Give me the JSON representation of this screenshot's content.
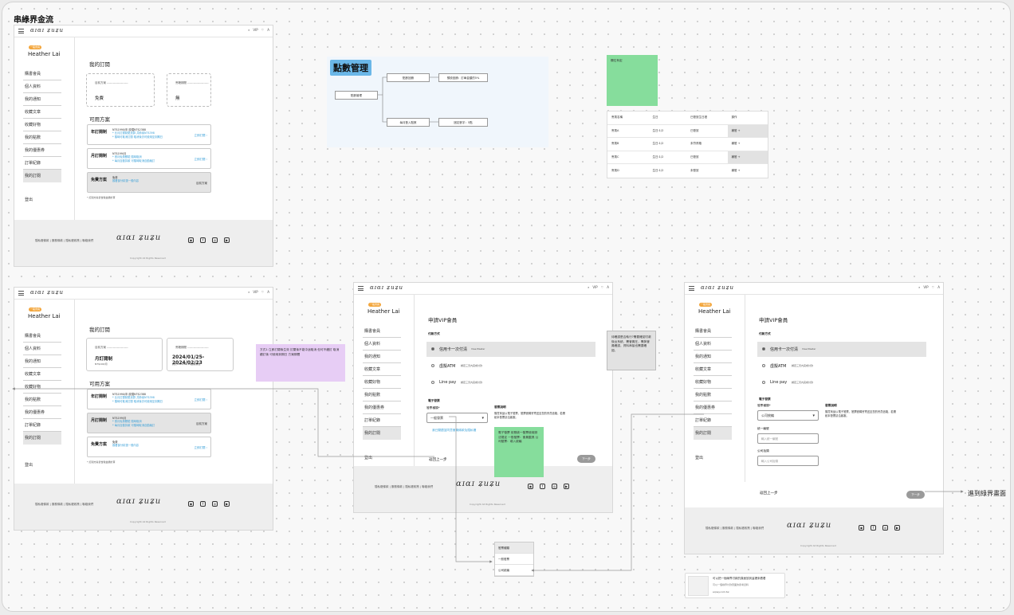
{
  "flow_title": "串綠界金流",
  "brand_top": "ɑɪɑɪ ʑuʑu",
  "brand_footer": "ɑɪɑɪ ʑuʑu",
  "top_icons": [
    "⌕",
    "VIP",
    "♡",
    "A"
  ],
  "user": {
    "badge": "一般會員",
    "name": "Heather Lai"
  },
  "menu": [
    "購書會員",
    "個人資料",
    "我的通知",
    "收藏文章",
    "收藏好物",
    "我的點數",
    "我的優惠券",
    "訂單紀錄",
    "我的訂閱"
  ],
  "logout": "登出",
  "footer": {
    "links": "隱私權條款  |  服務條款  |  隱私權政策  |  聯絡我們",
    "icons": [
      "◉",
      "f",
      "◎",
      "▶"
    ],
    "copyright": "Copyright All Rights Reserved"
  },
  "subscription": {
    "title": "我的訂閱",
    "current_plan_label": "目前方案 ---------------------",
    "period_label": "會籍期間 ---------------------",
    "current_plan_value_1": "免費",
    "period_value_1": "無",
    "current_plan_value_2": "月訂閱制",
    "current_plan_value_2_sub": "NT$199/月",
    "period_value_2": "2024/01/25-2024/02/23",
    "period_value_2_sub": "將於2024/02/24續訂帳號",
    "plans_title": "可用方案",
    "plans": [
      {
        "name": "年訂閱制",
        "info": "NT$1990/年 原價NT$2388",
        "l2": "* 比月訂閱制更划算 共節省NT$398",
        "l3": "* 隨時可取消訂閱 取消後仍可使用至到期日",
        "btn": "立即訂閱 ›"
      },
      {
        "name": "月訂閱制",
        "info": "NT$199/月",
        "l2": "* 首月免費體驗 隨時取消",
        "l3": "* 每月自動扣款 可隨時取消自動續訂",
        "btn": "立即訂閱 ›"
      },
      {
        "name": "免費方案",
        "info": "免費",
        "l2": "觀看部分精選一般內容",
        "l3": "",
        "btn": "目前方案"
      }
    ],
    "note": "* 訂閱方案皆含稅金額計算"
  },
  "vip": {
    "title": "申請VIP會員",
    "pay_label": "付款方式",
    "pay_options": [
      {
        "label": "信用卡一次付清",
        "sub": "Visa,Master"
      },
      {
        "label": "虛擬ATM",
        "sub": "綁定三天內完成付款"
      },
      {
        "label": "Line pay",
        "sub": "綁定三天內完成付款"
      }
    ],
    "invoice_label": "電子發票",
    "invoice_type_label": "發票種類*",
    "invoice_type_value_a": "一般發票",
    "invoice_type_value_b": "公司統編",
    "invoice_desc_title": "發票說明",
    "invoice_desc": "購買商品以電子發票，發票號碼會寄送至您的會員信箱，若需紙本發票請洽客服。",
    "agree": "我已閱讀並同意會員條款及隱私權",
    "tax_id_label": "統一編號",
    "tax_id_ph": "輸入統一編號",
    "company_label": "公司抬頭",
    "company_ph": "輸入公司抬頭",
    "back": "返回上一步",
    "next": "下一步"
  },
  "diagram": {
    "title": "點數管理",
    "root": "點數管理",
    "n1": "點數回饋",
    "n1b": "預設回饋：訂單金額的5%",
    "n2": "每月登入點數",
    "n2b": "固定數字：5點"
  },
  "notes": {
    "green_top": "欄位有定",
    "purple": "方式1:立即訂閱後生效 訂閱後不能中途取消 但可不續訂 取消續訂後 可使用到期日 方案期間",
    "grey": "待確認是否執行?需要確認付款後台系統，需會員在，需與會員確認，資料串接也需要確認。",
    "green_mid": "電子發票 依照統一發票使用辦法規定 一般發票：會員載具 公司發票：填入統編"
  },
  "table": {
    "header": [
      "會員名稱",
      "生日",
      "已發放生日禮",
      "操作"
    ],
    "rows": [
      [
        "會員A",
        "生日:1/2",
        "已發放",
        "補發 +"
      ],
      [
        "會員B",
        "生日:1/2",
        "未符資格",
        "補發 +"
      ],
      [
        "會員C",
        "生日:1/2",
        "已發放",
        "補發 +"
      ],
      [
        "會員D",
        "生日:1/2",
        "未發放",
        "補發 +"
      ]
    ]
  },
  "dropdown": [
    "發票種類",
    "一般發票",
    "公司統編"
  ],
  "arrow_label": "進到綠界畫面",
  "link_card": {
    "title": "可以把一個綠界付款的頁面放到這裡來看看",
    "sub": "可以一個綠界付款頁面的參考資料",
    "site": "ecpay.com.tw"
  },
  "colors": {
    "accent_blue": "#3aa0d8",
    "badge_orange": "#f3a63c",
    "sticky_green": "#86dd9c",
    "sticky_purple": "#e7cdf5",
    "diagram_title": "#6ab7e8"
  }
}
